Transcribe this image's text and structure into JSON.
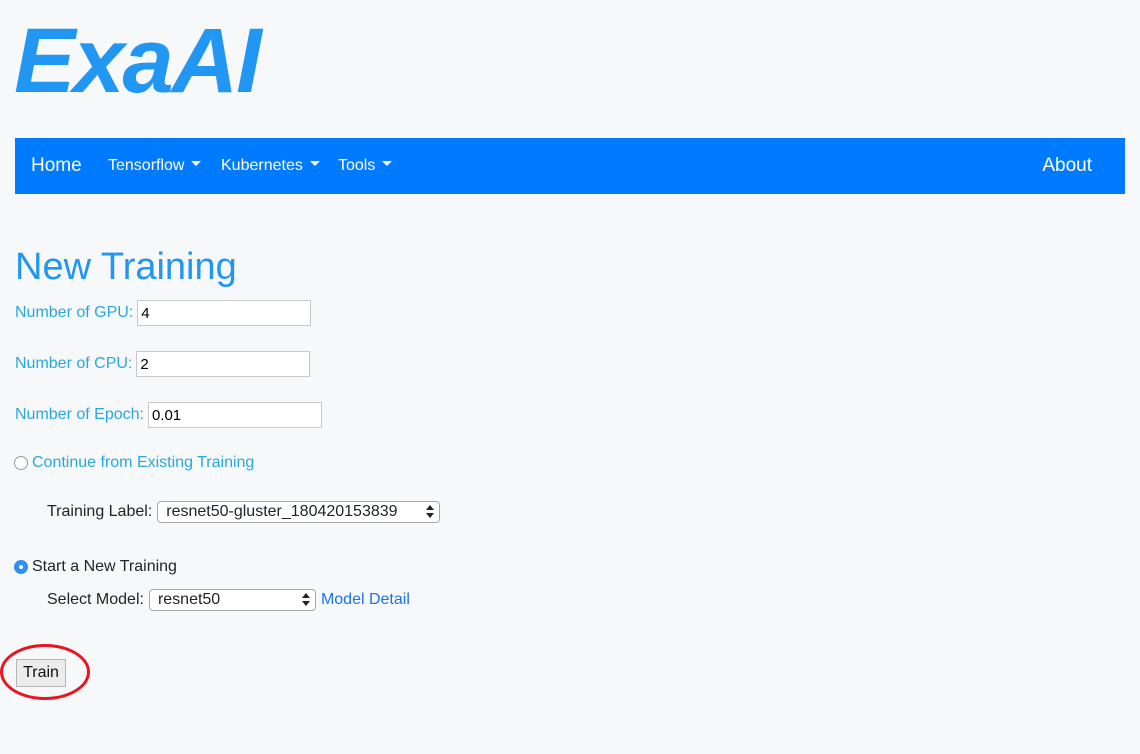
{
  "logo": {
    "text": "ExaAI"
  },
  "nav": {
    "home": "Home",
    "items": [
      {
        "label": "Tensorflow"
      },
      {
        "label": "Kubernetes"
      },
      {
        "label": "Tools"
      }
    ],
    "about": "About",
    "background_color": "#007bff"
  },
  "page_title": "New Training",
  "form": {
    "gpu": {
      "label": "Number of GPU:",
      "value": "4"
    },
    "cpu": {
      "label": "Number of CPU:",
      "value": "2"
    },
    "epoch": {
      "label": "Number of Epoch:",
      "value": "0.01"
    },
    "continue_option": {
      "label": "Continue from Existing Training",
      "checked": false
    },
    "training_label": {
      "label": "Training Label:",
      "selected": "resnet50-gluster_180420153839"
    },
    "new_option": {
      "label": "Start a New Training",
      "checked": true
    },
    "select_model": {
      "label": "Select Model:",
      "selected": "resnet50"
    },
    "model_detail_link": "Model Detail",
    "train_button": "Train"
  },
  "colors": {
    "accent": "#2196f3",
    "label": "#29a8e0",
    "highlight_ring": "#e8141e"
  }
}
